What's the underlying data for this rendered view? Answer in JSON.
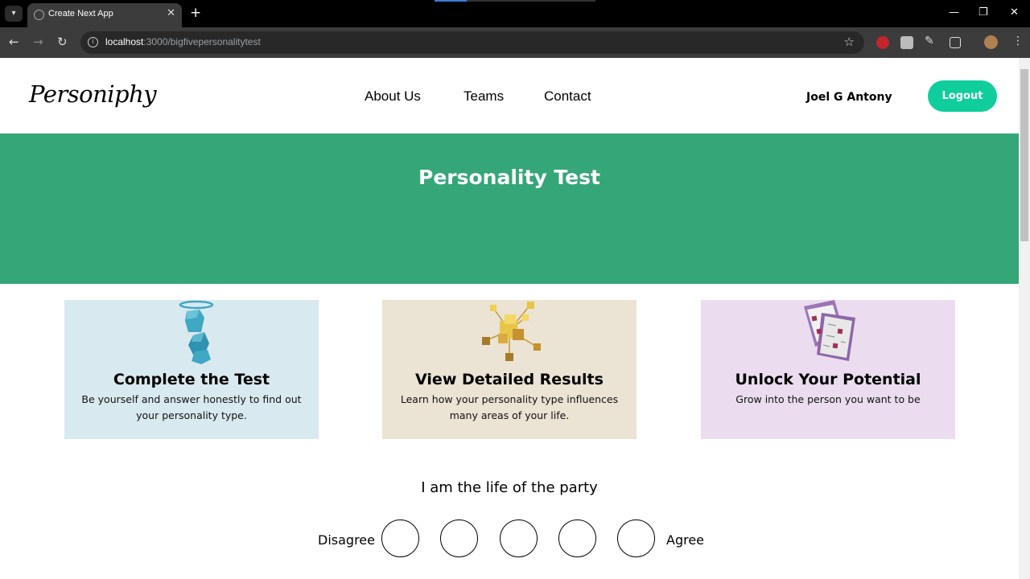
{
  "browser": {
    "tab_title": "Create Next App",
    "url_host": "localhost",
    "url_rest": ":3000/bigfivepersonalitytest"
  },
  "header": {
    "logo": "Personiphy",
    "nav": [
      "About Us",
      "Teams",
      "Contact"
    ],
    "user_name": "Joel G Antony",
    "logout_label": "Logout"
  },
  "hero": {
    "title": "Personality Test"
  },
  "cards": [
    {
      "title": "Complete the Test",
      "text": "Be yourself and answer honestly to find out your personality type.",
      "bg": "#d9e9f0",
      "icon": "cube-figure-illustration"
    },
    {
      "title": "View Detailed Results",
      "text": "Learn how your personality type influences many areas of your life.",
      "bg": "#ebe3d3",
      "icon": "cube-network-illustration"
    },
    {
      "title": "Unlock Your Potential",
      "text": "Grow into the person you want to be",
      "bg": "#ebdcf0",
      "icon": "documents-illustration"
    }
  ],
  "question": {
    "text": "I am the life of the party",
    "left_label": "Disagree",
    "right_label": "Agree",
    "option_count": 5
  },
  "colors": {
    "hero_bg": "#35a678",
    "logout_bg": "#10ce9c"
  }
}
